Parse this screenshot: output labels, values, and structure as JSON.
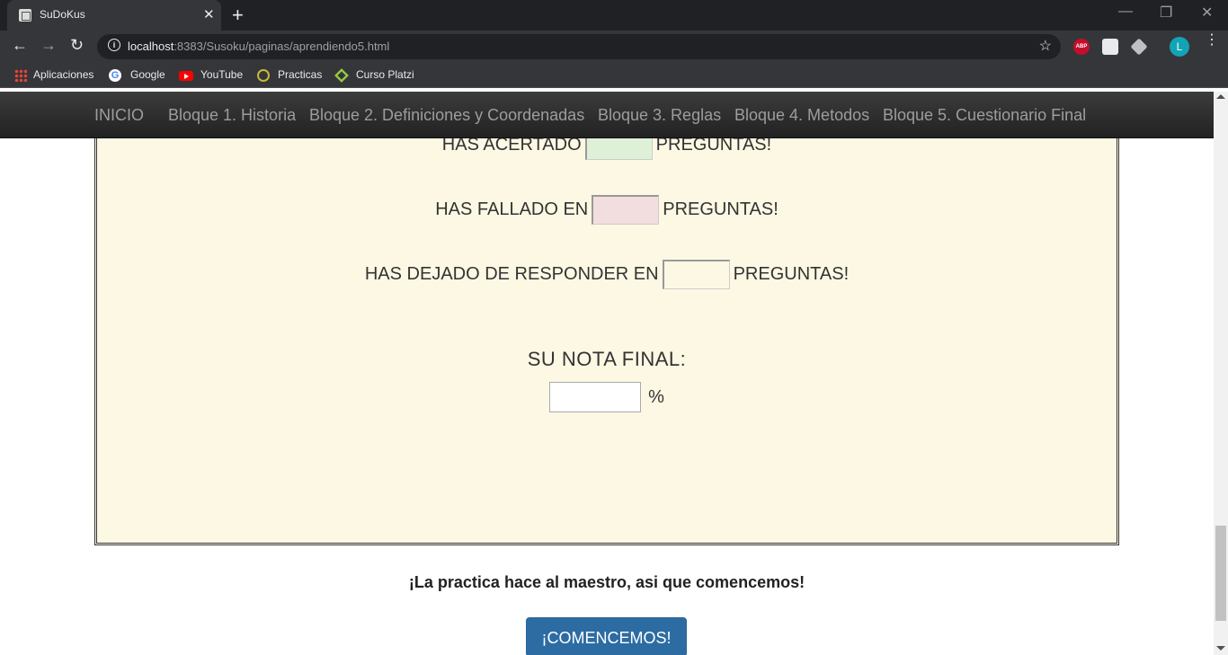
{
  "browser": {
    "tab_title": "SuDoKus",
    "tab_close": "✕",
    "new_tab": "+",
    "url_host": "localhost",
    "url_rest": ":8383/Susoku/paginas/aprendiendo5.html",
    "window_controls": [
      "—",
      "❐",
      "✕"
    ],
    "profile_initial": "L",
    "ext_abp": "ABP",
    "bookmarks": [
      {
        "label": "Aplicaciones",
        "icon": "apps-icon"
      },
      {
        "label": "Google",
        "icon": "google-icon"
      },
      {
        "label": "YouTube",
        "icon": "youtube-icon"
      },
      {
        "label": "Practicas",
        "icon": "practicas-icon"
      },
      {
        "label": "Curso Platzi",
        "icon": "platzi-icon"
      }
    ]
  },
  "navbar": {
    "items": [
      "INICIO",
      "Bloque 1. Historia",
      "Bloque 2. Definiciones y Coordenadas",
      "Bloque 3. Reglas",
      "Bloque 4. Metodos",
      "Bloque 5. Cuestionario Final"
    ]
  },
  "results": {
    "correct_prefix": "HAS ACERTADO",
    "wrong_prefix": "HAS FALLADO EN",
    "unanswered_prefix": "HAS DEJADO DE RESPONDER EN",
    "suffix": "PREGUNTAS!",
    "correct_value": "",
    "wrong_value": "",
    "unanswered_value": "",
    "final_title": "SU NOTA FINAL:",
    "final_value": "",
    "percent": "%"
  },
  "footer": {
    "motto": "¡La practica hace al maestro, asi que comencemos!",
    "start_button": "¡COMENCEMOS!"
  },
  "colors": {
    "navbar": "#222222",
    "panel_bg": "#fdf8e4",
    "correct_box": "#dff0d8",
    "wrong_box": "#f2dede",
    "button": "#2d6ca2"
  }
}
